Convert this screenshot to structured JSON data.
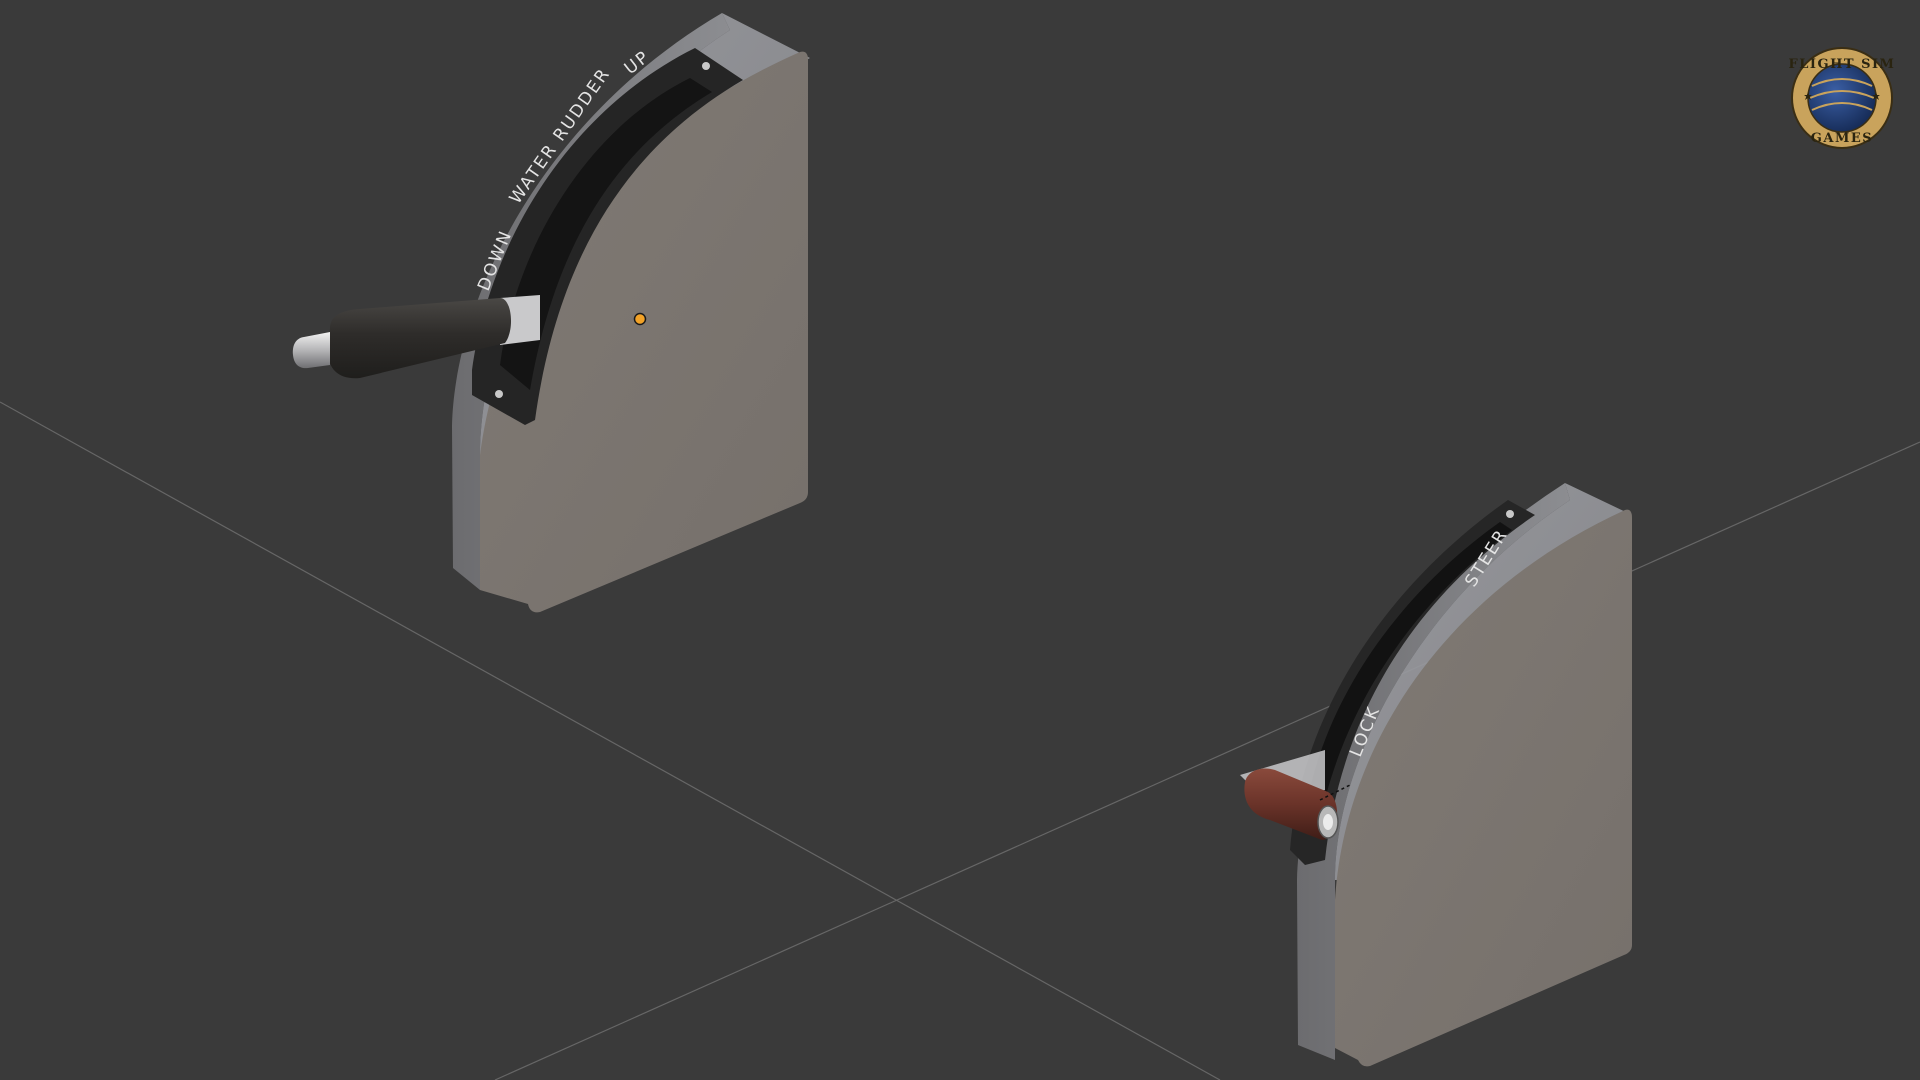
{
  "scene": {
    "background_color": "#3a3a3a",
    "grid_line_color": "#6a6a6a",
    "origin_marker_color": "#f2a227"
  },
  "lever_water_rudder": {
    "body_color": "#7d7771",
    "handle_color": "#2f2d2b",
    "label_down": "DOWN",
    "label_title": "WATER RUDDER",
    "label_up": "UP"
  },
  "lever_steer_lock": {
    "body_color": "#7d7771",
    "handle_color": "#6a3329",
    "label_steer": "STEER",
    "label_lock": "LOCK"
  },
  "logo": {
    "icon": "globe-logo-icon",
    "text_top": "FLIGHT SIM",
    "text_bottom": "GAMES",
    "ring_color": "#c9a35c",
    "globe_color": "#1f3d78"
  }
}
